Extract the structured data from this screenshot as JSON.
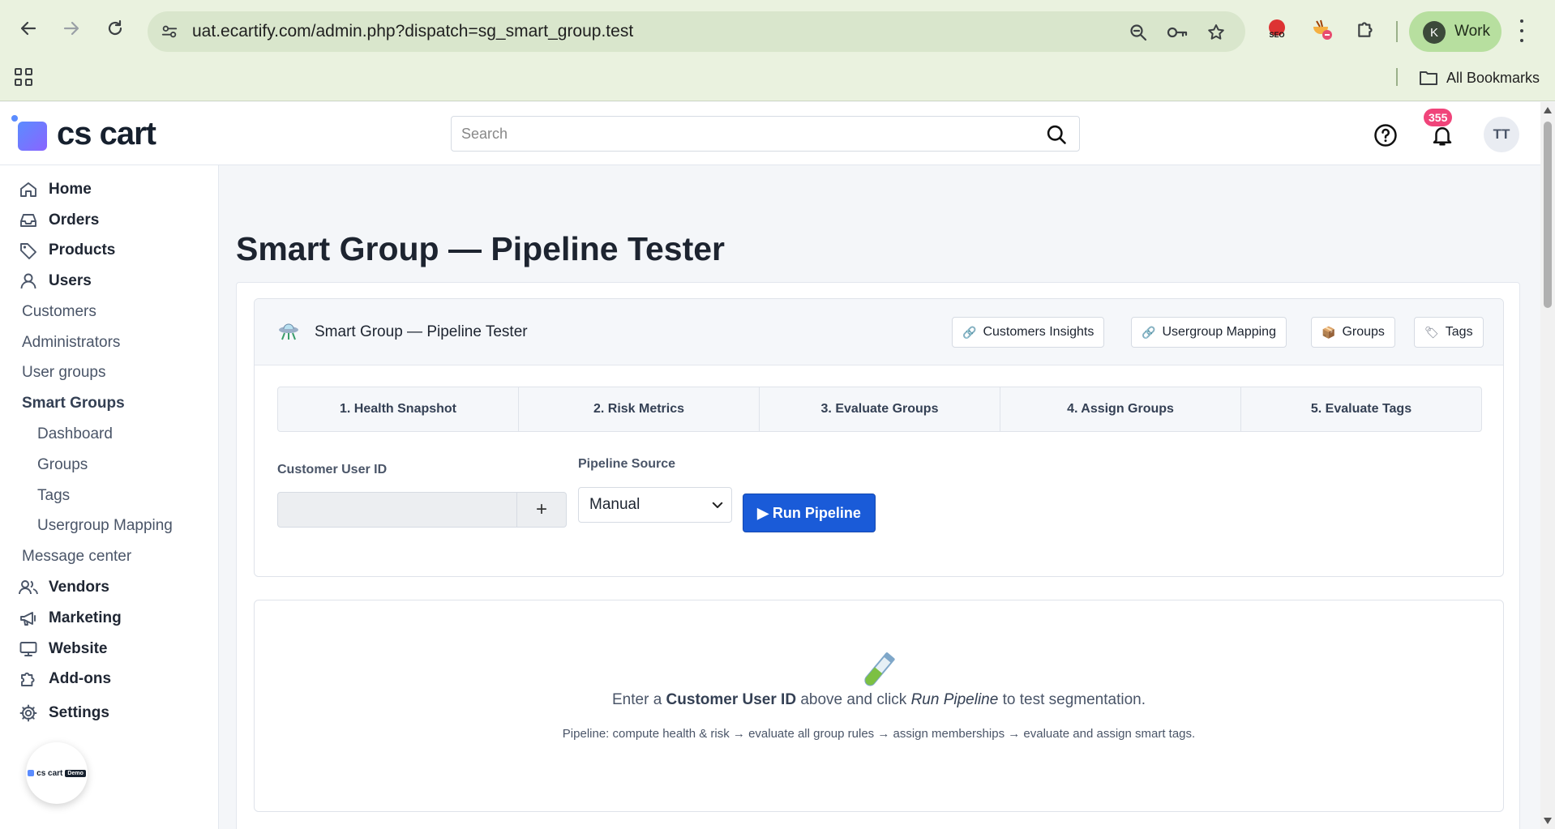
{
  "browser": {
    "url": "uat.ecartify.com/admin.php?dispatch=sg_smart_group.test",
    "profile_initial": "K",
    "profile_name": "Work",
    "bookmarks_label": "All Bookmarks"
  },
  "header": {
    "logo_text": "cs cart",
    "search_placeholder": "Search",
    "notification_count": "355",
    "user_initials": "TT"
  },
  "sidebar": {
    "items": [
      {
        "label": "Home",
        "icon": "home-icon"
      },
      {
        "label": "Orders",
        "icon": "inbox-icon"
      },
      {
        "label": "Products",
        "icon": "tag-icon"
      },
      {
        "label": "Users",
        "icon": "user-icon"
      },
      {
        "label": "Customers"
      },
      {
        "label": "Administrators"
      },
      {
        "label": "User groups"
      },
      {
        "label": "Smart Groups"
      },
      {
        "label": "Dashboard"
      },
      {
        "label": "Groups"
      },
      {
        "label": "Tags"
      },
      {
        "label": "Usergroup Mapping"
      },
      {
        "label": "Message center"
      },
      {
        "label": "Vendors",
        "icon": "vendors-icon"
      },
      {
        "label": "Marketing",
        "icon": "megaphone-icon"
      },
      {
        "label": "Website",
        "icon": "monitor-icon"
      },
      {
        "label": "Add-ons",
        "icon": "puzzle-icon"
      },
      {
        "label": "Settings",
        "icon": "gear-icon"
      }
    ],
    "floating_logo_text": "cs cart",
    "floating_logo_tag": "Demo"
  },
  "main": {
    "page_title": "Smart Group — Pipeline Tester",
    "card_title": "Smart Group — Pipeline Tester",
    "links": [
      {
        "label": "Customers Insights",
        "icon": "link-icon"
      },
      {
        "label": "Usergroup Mapping",
        "icon": "link-icon"
      },
      {
        "label": "Groups",
        "icon": "box-icon"
      },
      {
        "label": "Tags",
        "icon": "label-icon"
      }
    ],
    "steps": [
      "1. Health Snapshot",
      "2. Risk Metrics",
      "3. Evaluate Groups",
      "4. Assign Groups",
      "5. Evaluate Tags"
    ],
    "form": {
      "uid_label": "Customer User ID",
      "uid_value": "",
      "plus_label": "+",
      "source_label": "Pipeline Source",
      "source_value": "Manual",
      "run_label": "▶ Run Pipeline"
    },
    "empty": {
      "msg_pre": "Enter a ",
      "msg_bold": "Customer User ID",
      "msg_mid": " above and click ",
      "msg_italic": "Run Pipeline",
      "msg_post": " to test segmentation.",
      "sub": "Pipeline: compute health & risk → evaluate all group rules → assign memberships → evaluate and assign smart tags."
    }
  },
  "colors": {
    "chrome_bg": "#eaf2df",
    "primary_button": "#1a5bd8",
    "badge": "#f0447a"
  }
}
